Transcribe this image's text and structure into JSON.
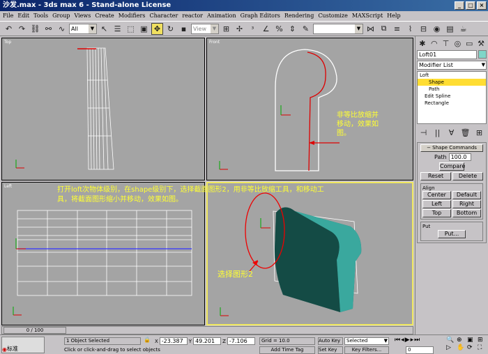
{
  "window": {
    "title": "沙发.max - 3ds max 6 - Stand-alone License"
  },
  "menu": [
    "File",
    "Edit",
    "Tools",
    "Group",
    "Views",
    "Create",
    "Modifiers",
    "Character",
    "reactor",
    "Animation",
    "Graph Editors",
    "Rendering",
    "Customize",
    "MAXScript",
    "Help"
  ],
  "toolbar": {
    "selection_filter": "All",
    "view_dropdown": "View"
  },
  "viewports": {
    "top": {
      "label": "Top"
    },
    "front": {
      "label": "Front",
      "annotation_lines": [
        "非等比放缩并",
        "移动，效果如",
        "图。"
      ]
    },
    "left": {
      "label": "Left",
      "annotation_lines": [
        "打开loft次物体级别，在shape级别下，选择截面图形2，用非等比放缩工具，和移动工",
        "具，将截面图形缩小并移动，效果如图。"
      ]
    },
    "perspective": {
      "annotation": "选择图形2"
    }
  },
  "command_panel": {
    "object_name": "Loft01",
    "modifier_list": "Modifier List",
    "stack": [
      "Loft",
      "Shape",
      "Path",
      "Edit Spline",
      "Rectangle"
    ],
    "rollout_title": "Shape Commands",
    "path_label": "Path",
    "path_value": "100.0",
    "compare": "Compare",
    "reset": "Reset",
    "delete": "Delete",
    "align_label": "Align",
    "center": "Center",
    "default": "Default",
    "left": "Left",
    "right": "Right",
    "top": "Top",
    "bottom": "Bottom",
    "put_label": "Put",
    "put": "Put..."
  },
  "status": {
    "time_slider": "0 / 100",
    "selected": "1 Object Selected",
    "prompt": "Click or click-and-drag to select objects",
    "x_label": "X",
    "x": "-23.387",
    "y_label": "Y",
    "y": "49.201",
    "z_label": "Z",
    "z": "-7.106",
    "grid": "Grid = 10.0",
    "add_time_tag": "Add Time Tag",
    "auto_key": "Auto Key",
    "selected_set": "Selected",
    "set_key": "Set Key",
    "filters": "Key Filters...",
    "frame": "0",
    "lang": "标准"
  }
}
